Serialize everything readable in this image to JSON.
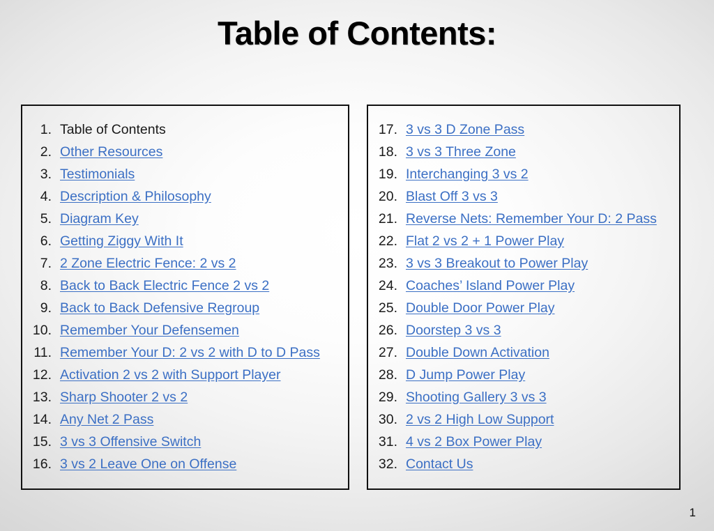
{
  "slide": {
    "title": "Table of Contents:",
    "page_number": "1",
    "link_color": "#3b6fc4",
    "text_color": "#1a1a1a",
    "border_color": "#101010",
    "background_center": "#ffffff",
    "background_edge": "#d7d7d7"
  },
  "columns": [
    {
      "name": "left-column",
      "items": [
        {
          "number": "1.",
          "label": "Table of Contents",
          "is_link": false
        },
        {
          "number": "2.",
          "label": "Other Resources",
          "is_link": true
        },
        {
          "number": "3.",
          "label": "Testimonials",
          "is_link": true
        },
        {
          "number": "4.",
          "label": "Description & Philosophy",
          "is_link": true
        },
        {
          "number": "5.",
          "label": "Diagram Key",
          "is_link": true
        },
        {
          "number": "6.",
          "label": "Getting Ziggy With It",
          "is_link": true
        },
        {
          "number": "7.",
          "label": "2 Zone Electric Fence: 2 vs 2",
          "is_link": true
        },
        {
          "number": "8.",
          "label": "Back to Back Electric Fence 2 vs 2",
          "is_link": true
        },
        {
          "number": "9.",
          "label": "Back to Back Defensive Regroup",
          "is_link": true
        },
        {
          "number": "10.",
          "label": "Remember Your Defensemen",
          "is_link": true
        },
        {
          "number": "11.",
          "label": "Remember Your D: 2 vs 2 with D to D Pass",
          "is_link": true
        },
        {
          "number": "12.",
          "label": "Activation 2 vs 2 with Support Player",
          "is_link": true
        },
        {
          "number": "13.",
          "label": "Sharp Shooter 2 vs 2",
          "is_link": true
        },
        {
          "number": "14.",
          "label": "Any Net 2 Pass",
          "is_link": true
        },
        {
          "number": "15.",
          "label": "3 vs 3 Offensive Switch",
          "is_link": true
        },
        {
          "number": "16.",
          "label": "3 vs 2 Leave One on Offense",
          "is_link": true
        }
      ]
    },
    {
      "name": "right-column",
      "items": [
        {
          "number": "17.",
          "label": "3 vs 3 D Zone Pass",
          "is_link": true
        },
        {
          "number": "18.",
          "label": "3 vs 3 Three Zone",
          "is_link": true
        },
        {
          "number": "19.",
          "label": "Interchanging 3 vs 2",
          "is_link": true
        },
        {
          "number": "20.",
          "label": "Blast Off 3 vs 3",
          "is_link": true
        },
        {
          "number": "21.",
          "label": "Reverse Nets: Remember Your D: 2 Pass",
          "is_link": true
        },
        {
          "number": "22.",
          "label": "Flat 2 vs 2 + 1 Power Play",
          "is_link": true
        },
        {
          "number": "23.",
          "label": "3 vs 3 Breakout to Power Play",
          "is_link": true
        },
        {
          "number": "24.",
          "label": "Coaches’ Island Power Play",
          "is_link": true
        },
        {
          "number": "25.",
          "label": "Double Door Power Play",
          "is_link": true
        },
        {
          "number": "26.",
          "label": "Doorstep 3 vs 3",
          "is_link": true
        },
        {
          "number": "27.",
          "label": "Double Down Activation",
          "is_link": true
        },
        {
          "number": "28.",
          "label": "D Jump Power Play",
          "is_link": true
        },
        {
          "number": "29.",
          "label": "Shooting Gallery 3 vs 3",
          "is_link": true
        },
        {
          "number": "30.",
          "label": "2 vs 2 High Low Support",
          "is_link": true
        },
        {
          "number": "31.",
          "label": "4 vs 2 Box Power Play",
          "is_link": true
        },
        {
          "number": "32.",
          "label": "Contact Us",
          "is_link": true
        }
      ]
    }
  ]
}
